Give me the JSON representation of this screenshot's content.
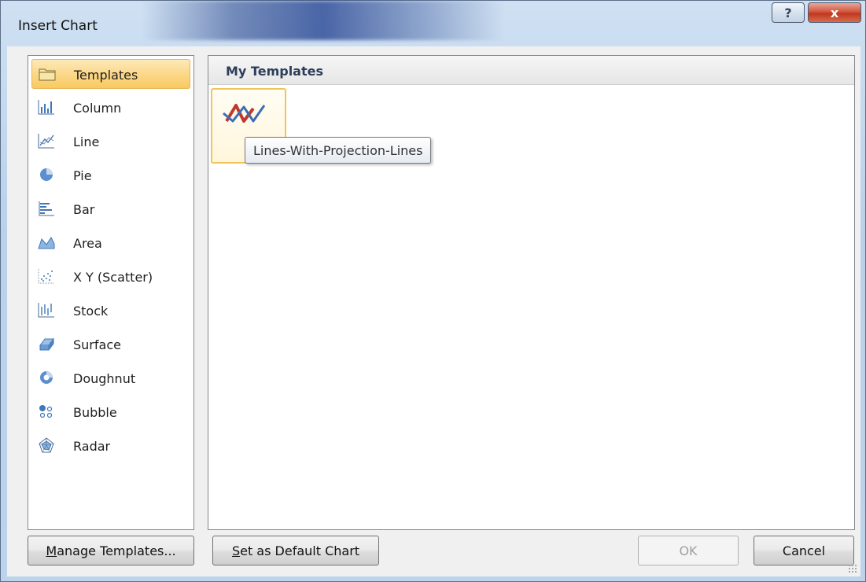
{
  "window": {
    "title": "Insert Chart",
    "help_label": "?",
    "close_label": "x"
  },
  "categories": [
    {
      "label": "Templates",
      "icon": "folder-icon",
      "selected": true
    },
    {
      "label": "Column",
      "icon": "column-chart-icon"
    },
    {
      "label": "Line",
      "icon": "line-chart-icon"
    },
    {
      "label": "Pie",
      "icon": "pie-chart-icon"
    },
    {
      "label": "Bar",
      "icon": "bar-chart-icon"
    },
    {
      "label": "Area",
      "icon": "area-chart-icon"
    },
    {
      "label": "X Y (Scatter)",
      "icon": "scatter-chart-icon"
    },
    {
      "label": "Stock",
      "icon": "stock-chart-icon"
    },
    {
      "label": "Surface",
      "icon": "surface-chart-icon"
    },
    {
      "label": "Doughnut",
      "icon": "doughnut-chart-icon"
    },
    {
      "label": "Bubble",
      "icon": "bubble-chart-icon"
    },
    {
      "label": "Radar",
      "icon": "radar-chart-icon"
    }
  ],
  "main": {
    "section_title": "My Templates",
    "templates": [
      {
        "icon": "lines-with-projection-lines-icon",
        "tooltip": "Lines-With-Projection-Lines"
      }
    ]
  },
  "buttons": {
    "manage_accel": "M",
    "manage_rest": "anage Templates...",
    "default_accel": "S",
    "default_rest": "et as Default Chart",
    "ok_label": "OK",
    "cancel_label": "Cancel"
  },
  "colors": {
    "selection": "#fbd88a",
    "panel_border": "#828790",
    "section_title": "#2c3e5a",
    "close_button": "#c0381e"
  }
}
